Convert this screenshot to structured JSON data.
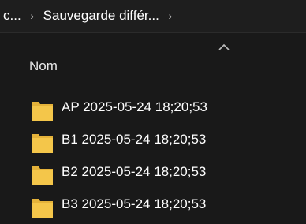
{
  "breadcrumb": {
    "items": [
      "c...",
      "Sauvegarde différ..."
    ],
    "separator": "›"
  },
  "columns": {
    "name_label": "Nom",
    "sort_icon": "chevron-up-icon"
  },
  "files": [
    {
      "name": "AP 2025-05-24 18;20;53",
      "icon": "folder-icon"
    },
    {
      "name": "B1 2025-05-24 18;20;53",
      "icon": "folder-icon"
    },
    {
      "name": "B2 2025-05-24 18;20;53",
      "icon": "folder-icon"
    },
    {
      "name": "B3 2025-05-24 18;20;53",
      "icon": "folder-icon"
    }
  ],
  "colors": {
    "background": "#191919",
    "folder": "#f4c64a",
    "folder_tab": "#e4b23a"
  }
}
